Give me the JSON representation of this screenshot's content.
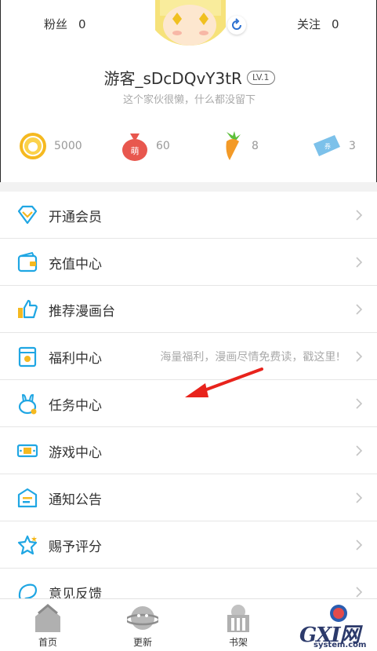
{
  "header": {
    "fans_label": "粉丝",
    "fans_count": "0",
    "following_label": "关注",
    "following_count": "0",
    "username": "游客_sDcDQvY3tR",
    "level": "LV.1",
    "signature": "这个家伙很懒，什么都没留下"
  },
  "assets": {
    "coins": "5000",
    "moe": "60",
    "carrots": "8",
    "tickets": "3"
  },
  "menu": [
    {
      "label": "开通会员",
      "icon": "diamond-icon",
      "hint": ""
    },
    {
      "label": "充值中心",
      "icon": "wallet-icon",
      "hint": ""
    },
    {
      "label": "推荐漫画台",
      "icon": "thumbs-up-icon",
      "hint": ""
    },
    {
      "label": "福利中心",
      "icon": "envelope-icon",
      "hint": "海量福利，漫画尽情免费读，戳这里!"
    },
    {
      "label": "任务中心",
      "icon": "bunny-icon",
      "hint": ""
    },
    {
      "label": "游戏中心",
      "icon": "game-icon",
      "hint": ""
    },
    {
      "label": "通知公告",
      "icon": "notice-icon",
      "hint": ""
    },
    {
      "label": "赐予评分",
      "icon": "star-icon",
      "hint": ""
    },
    {
      "label": "意见反馈",
      "icon": "feedback-icon",
      "hint": ""
    }
  ],
  "nav": {
    "home": "首页",
    "update": "更新",
    "shelf": "书架"
  },
  "watermark": {
    "main": "GXI网",
    "sub": "system.com"
  },
  "colors": {
    "accent_blue": "#1fa6e3",
    "annotation_red": "#e8231c",
    "coin_gold": "#f5b920",
    "moe_red": "#e8574e",
    "carrot_orange": "#f39a27"
  }
}
